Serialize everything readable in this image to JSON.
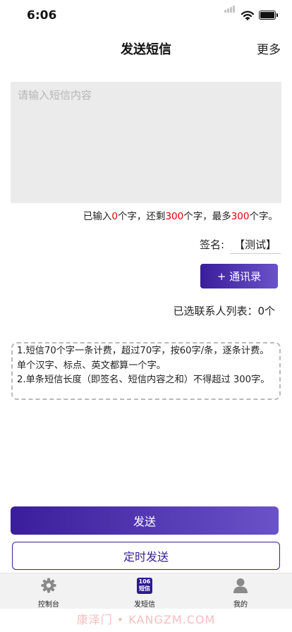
{
  "status_bar": {
    "time": "6:06"
  },
  "nav": {
    "title": "发送短信",
    "more_label": "更多"
  },
  "sms": {
    "placeholder": "请输入短信内容",
    "value": ""
  },
  "counter": {
    "p1": "已输入",
    "entered": "0",
    "p2": "个字，还剩",
    "remaining": "300",
    "p3": "个字，最多",
    "max": "300",
    "p4": "个字。"
  },
  "signature": {
    "label": "签名:",
    "value": "【测试】"
  },
  "contacts_button": {
    "label": "+ 通讯录"
  },
  "selected": {
    "text": "已选联系人列表：0个"
  },
  "notes": {
    "line1": "1.短信70个字一条计费，超过70字，按60字/条，逐条计费。单个汉字、标点、英文都算一个字。",
    "line2": "2.单条短信长度（即签名、短信内容之和）不得超过 300字。"
  },
  "send_button": {
    "label": "发送"
  },
  "timed_button": {
    "label": "定时发送"
  },
  "tabbar": {
    "items": [
      {
        "label": "控制台",
        "icon": "gear-icon"
      },
      {
        "label": "发短信",
        "icon": "sms-106-icon",
        "badge_top": "106",
        "badge_bottom": "短信"
      },
      {
        "label": "我的",
        "icon": "person-icon"
      }
    ]
  },
  "watermark": "康泽门 • KANGZM.COM",
  "colors": {
    "accent": "#3a1d9a",
    "accent_light": "#6a52c8",
    "highlight_red": "#e60000",
    "tabbar_bg": "#f2f2f2"
  }
}
